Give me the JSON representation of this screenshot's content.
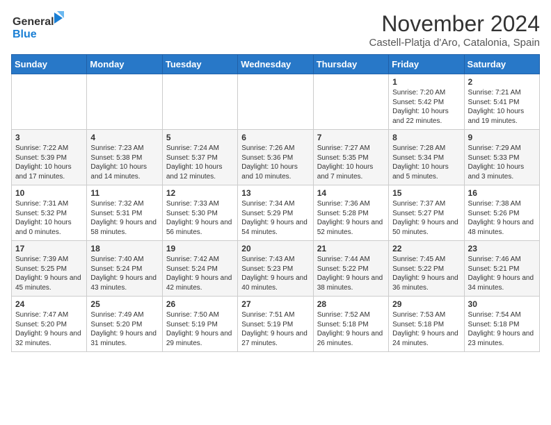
{
  "header": {
    "logo_general": "General",
    "logo_blue": "Blue",
    "title": "November 2024",
    "location": "Castell-Platja d'Aro, Catalonia, Spain"
  },
  "columns": [
    "Sunday",
    "Monday",
    "Tuesday",
    "Wednesday",
    "Thursday",
    "Friday",
    "Saturday"
  ],
  "weeks": [
    [
      {
        "day": "",
        "info": ""
      },
      {
        "day": "",
        "info": ""
      },
      {
        "day": "",
        "info": ""
      },
      {
        "day": "",
        "info": ""
      },
      {
        "day": "",
        "info": ""
      },
      {
        "day": "1",
        "info": "Sunrise: 7:20 AM\nSunset: 5:42 PM\nDaylight: 10 hours and 22 minutes."
      },
      {
        "day": "2",
        "info": "Sunrise: 7:21 AM\nSunset: 5:41 PM\nDaylight: 10 hours and 19 minutes."
      }
    ],
    [
      {
        "day": "3",
        "info": "Sunrise: 7:22 AM\nSunset: 5:39 PM\nDaylight: 10 hours and 17 minutes."
      },
      {
        "day": "4",
        "info": "Sunrise: 7:23 AM\nSunset: 5:38 PM\nDaylight: 10 hours and 14 minutes."
      },
      {
        "day": "5",
        "info": "Sunrise: 7:24 AM\nSunset: 5:37 PM\nDaylight: 10 hours and 12 minutes."
      },
      {
        "day": "6",
        "info": "Sunrise: 7:26 AM\nSunset: 5:36 PM\nDaylight: 10 hours and 10 minutes."
      },
      {
        "day": "7",
        "info": "Sunrise: 7:27 AM\nSunset: 5:35 PM\nDaylight: 10 hours and 7 minutes."
      },
      {
        "day": "8",
        "info": "Sunrise: 7:28 AM\nSunset: 5:34 PM\nDaylight: 10 hours and 5 minutes."
      },
      {
        "day": "9",
        "info": "Sunrise: 7:29 AM\nSunset: 5:33 PM\nDaylight: 10 hours and 3 minutes."
      }
    ],
    [
      {
        "day": "10",
        "info": "Sunrise: 7:31 AM\nSunset: 5:32 PM\nDaylight: 10 hours and 0 minutes."
      },
      {
        "day": "11",
        "info": "Sunrise: 7:32 AM\nSunset: 5:31 PM\nDaylight: 9 hours and 58 minutes."
      },
      {
        "day": "12",
        "info": "Sunrise: 7:33 AM\nSunset: 5:30 PM\nDaylight: 9 hours and 56 minutes."
      },
      {
        "day": "13",
        "info": "Sunrise: 7:34 AM\nSunset: 5:29 PM\nDaylight: 9 hours and 54 minutes."
      },
      {
        "day": "14",
        "info": "Sunrise: 7:36 AM\nSunset: 5:28 PM\nDaylight: 9 hours and 52 minutes."
      },
      {
        "day": "15",
        "info": "Sunrise: 7:37 AM\nSunset: 5:27 PM\nDaylight: 9 hours and 50 minutes."
      },
      {
        "day": "16",
        "info": "Sunrise: 7:38 AM\nSunset: 5:26 PM\nDaylight: 9 hours and 48 minutes."
      }
    ],
    [
      {
        "day": "17",
        "info": "Sunrise: 7:39 AM\nSunset: 5:25 PM\nDaylight: 9 hours and 45 minutes."
      },
      {
        "day": "18",
        "info": "Sunrise: 7:40 AM\nSunset: 5:24 PM\nDaylight: 9 hours and 43 minutes."
      },
      {
        "day": "19",
        "info": "Sunrise: 7:42 AM\nSunset: 5:24 PM\nDaylight: 9 hours and 42 minutes."
      },
      {
        "day": "20",
        "info": "Sunrise: 7:43 AM\nSunset: 5:23 PM\nDaylight: 9 hours and 40 minutes."
      },
      {
        "day": "21",
        "info": "Sunrise: 7:44 AM\nSunset: 5:22 PM\nDaylight: 9 hours and 38 minutes."
      },
      {
        "day": "22",
        "info": "Sunrise: 7:45 AM\nSunset: 5:22 PM\nDaylight: 9 hours and 36 minutes."
      },
      {
        "day": "23",
        "info": "Sunrise: 7:46 AM\nSunset: 5:21 PM\nDaylight: 9 hours and 34 minutes."
      }
    ],
    [
      {
        "day": "24",
        "info": "Sunrise: 7:47 AM\nSunset: 5:20 PM\nDaylight: 9 hours and 32 minutes."
      },
      {
        "day": "25",
        "info": "Sunrise: 7:49 AM\nSunset: 5:20 PM\nDaylight: 9 hours and 31 minutes."
      },
      {
        "day": "26",
        "info": "Sunrise: 7:50 AM\nSunset: 5:19 PM\nDaylight: 9 hours and 29 minutes."
      },
      {
        "day": "27",
        "info": "Sunrise: 7:51 AM\nSunset: 5:19 PM\nDaylight: 9 hours and 27 minutes."
      },
      {
        "day": "28",
        "info": "Sunrise: 7:52 AM\nSunset: 5:18 PM\nDaylight: 9 hours and 26 minutes."
      },
      {
        "day": "29",
        "info": "Sunrise: 7:53 AM\nSunset: 5:18 PM\nDaylight: 9 hours and 24 minutes."
      },
      {
        "day": "30",
        "info": "Sunrise: 7:54 AM\nSunset: 5:18 PM\nDaylight: 9 hours and 23 minutes."
      }
    ]
  ]
}
